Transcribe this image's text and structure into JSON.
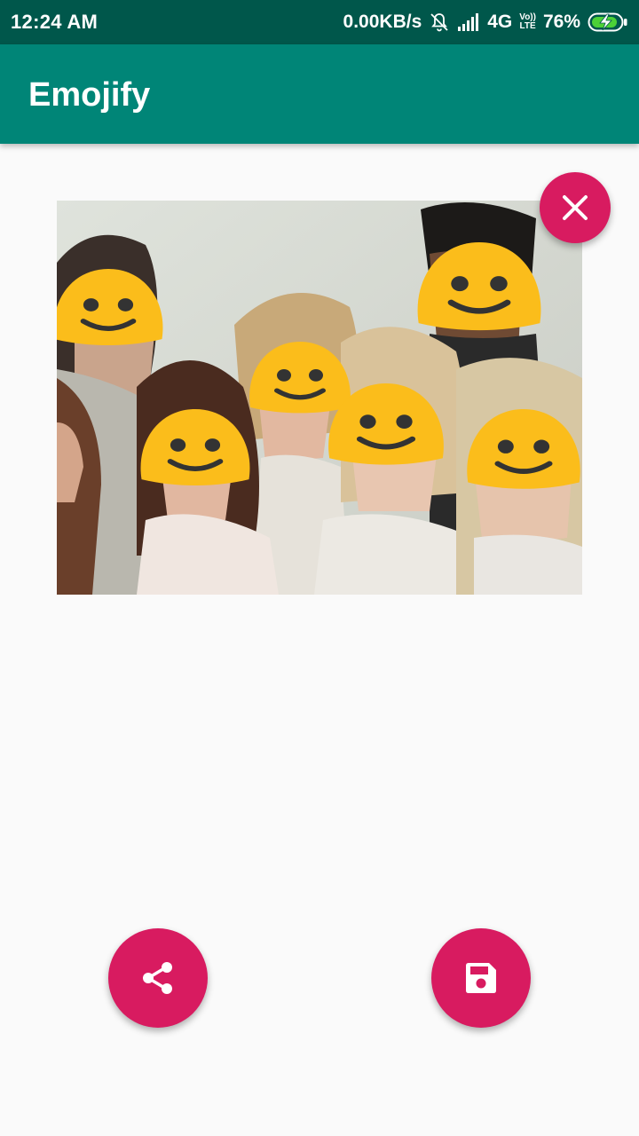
{
  "status_bar": {
    "time": "12:24 AM",
    "network_speed": "0.00KB/s",
    "network_type": "4G",
    "volte_line1": "Vo))",
    "volte_line2": "LTE",
    "battery_percent": "76%",
    "icons": [
      "bell-off-icon",
      "signal-icon",
      "battery-charging-icon"
    ]
  },
  "app_bar": {
    "title": "Emojify"
  },
  "photo": {
    "emoji_count": 6,
    "emoji_icon": "smiley-face-icon"
  },
  "actions": {
    "clear": {
      "icon": "close-icon"
    },
    "share": {
      "icon": "share-icon"
    },
    "save": {
      "icon": "save-icon"
    }
  },
  "colors": {
    "status_bar": "#00574b",
    "app_bar": "#008577",
    "accent": "#d81b60",
    "emoji": "#fbbd1b",
    "background": "#fafafa"
  }
}
